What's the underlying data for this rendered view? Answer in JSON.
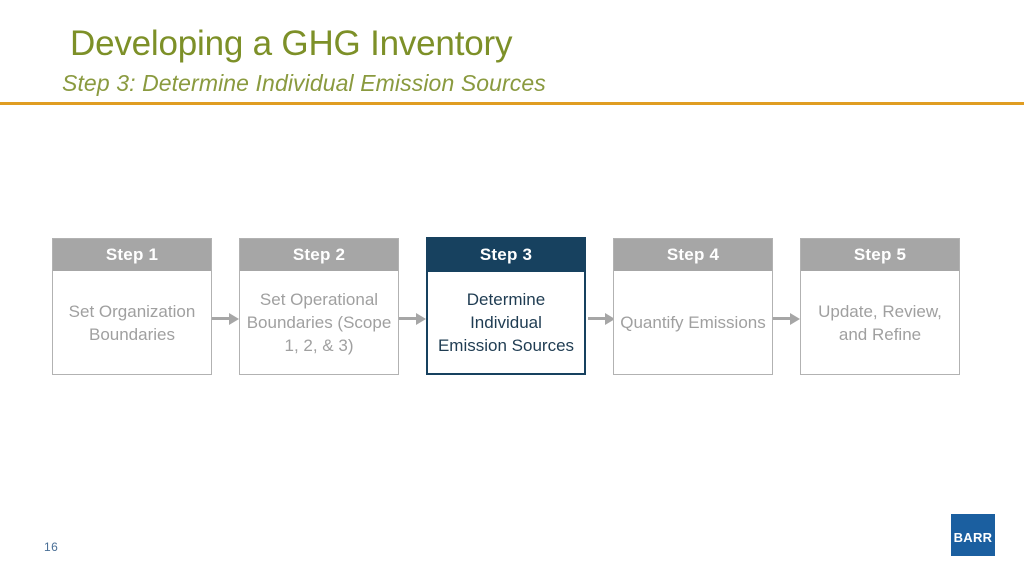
{
  "header": {
    "title": "Developing a GHG Inventory",
    "subtitle": "Step 3: Determine Individual Emission Sources",
    "title_color": "#7d9028",
    "rule_color": "#e09d22"
  },
  "flow": {
    "inactive_header_color": "#a6a6a6",
    "inactive_text_color": "#a0a0a0",
    "active_color": "#17415f",
    "steps": [
      {
        "id": "step-1",
        "header": "Step 1",
        "body": "Set Organization Boundaries",
        "active": false
      },
      {
        "id": "step-2",
        "header": "Step 2",
        "body": "Set Operational Boundaries (Scope 1, 2, & 3)",
        "active": false
      },
      {
        "id": "step-3",
        "header": "Step 3",
        "body": "Determine Individual Emission Sources",
        "active": true
      },
      {
        "id": "step-4",
        "header": "Step 4",
        "body": "Quantify Emissions",
        "active": false
      },
      {
        "id": "step-5",
        "header": "Step 5",
        "body": "Update, Review, and Refine",
        "active": false
      }
    ],
    "connectors": [
      {
        "id": "arrow-1",
        "icon": "arrow-right-icon"
      },
      {
        "id": "arrow-2",
        "icon": "arrow-right-icon"
      },
      {
        "id": "arrow-3",
        "icon": "arrow-right-icon"
      },
      {
        "id": "arrow-4",
        "icon": "arrow-right-icon"
      }
    ]
  },
  "footer": {
    "page_number": "16",
    "logo_text": "BARR",
    "logo_color": "#1b5fa0",
    "page_number_color": "#4a6f96"
  }
}
